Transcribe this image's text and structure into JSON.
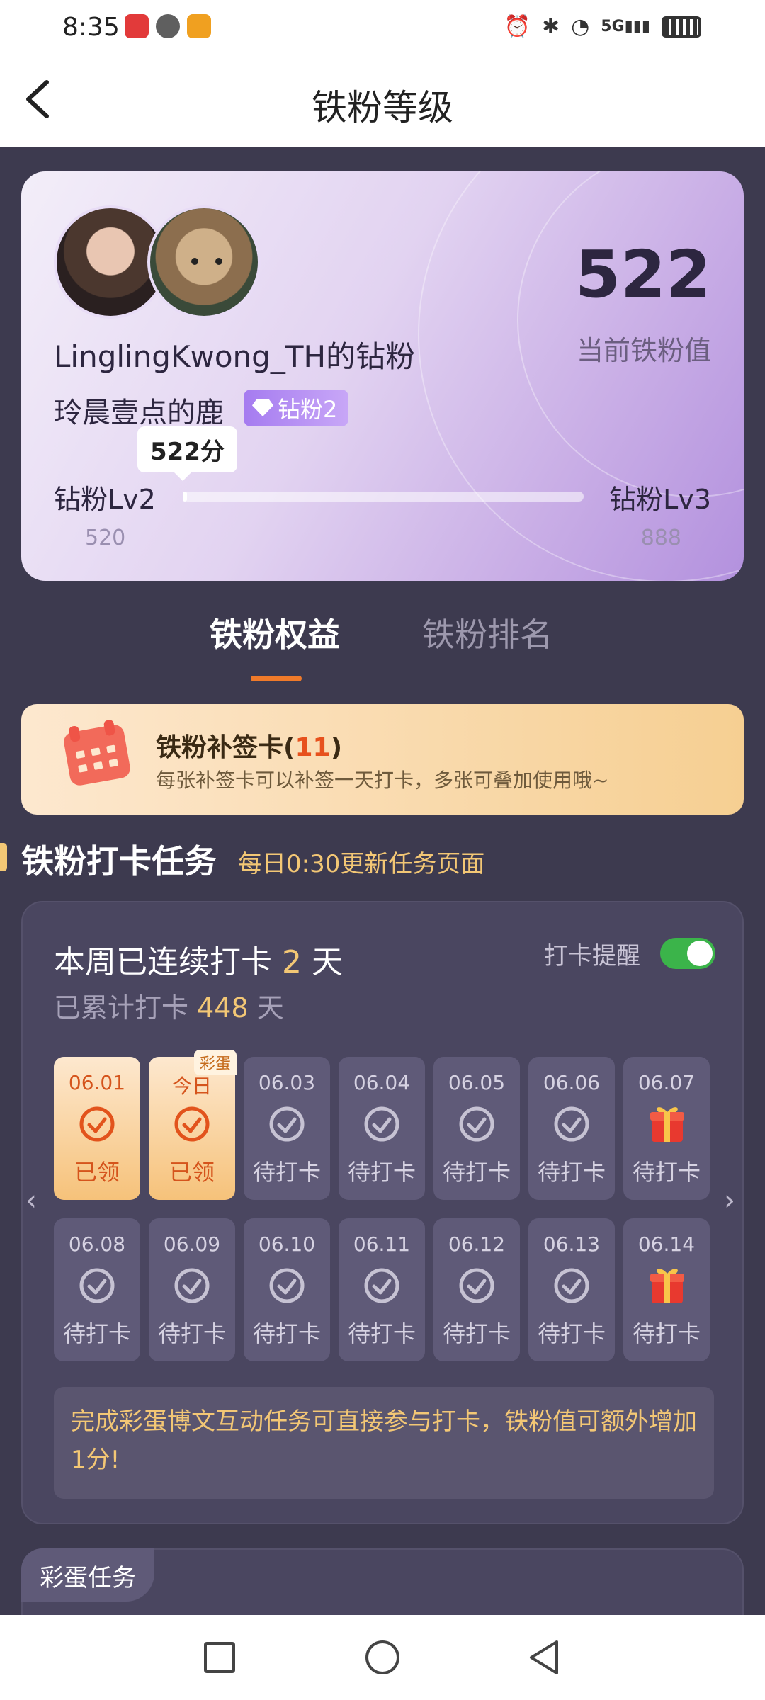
{
  "status_bar": {
    "time": "8:35",
    "network": "5G"
  },
  "header": {
    "title": "铁粉等级"
  },
  "profile": {
    "name": "LinglingKwong_TH的钻粉",
    "fan_name": "玲晨壹点的鹿",
    "badge": "钻粉2",
    "score": "522",
    "score_label": "当前铁粉值",
    "tooltip": "522分",
    "level_current": "钻粉Lv2",
    "level_next": "钻粉Lv3",
    "level_current_points": "520",
    "level_next_points": "888",
    "progress": 0.005
  },
  "tabs": [
    {
      "label": "铁粉权益",
      "active": true
    },
    {
      "label": "铁粉排名",
      "active": false
    }
  ],
  "sign_card": {
    "title_prefix": "铁粉补签卡(",
    "count": "11",
    "title_suffix": ")",
    "desc": "每张补签卡可以补签一天打卡，多张可叠加使用哦~"
  },
  "checkin": {
    "section_title": "铁粉打卡任务",
    "section_sub": "每日0:30更新任务页面",
    "streak_prefix": "本周已连续打卡 ",
    "streak_days": "2",
    "streak_suffix": " 天",
    "total_prefix": "已累计打卡 ",
    "total_days": "448",
    "total_suffix": " 天",
    "remind_label": "打卡提醒",
    "remind_on": true,
    "egg_tag": "彩蛋",
    "days": [
      {
        "date": "06.01",
        "label": "已领",
        "state": "done",
        "icon": "check-icon"
      },
      {
        "date": "今日",
        "label": "已领",
        "state": "done",
        "icon": "check-icon"
      },
      {
        "date": "06.03",
        "label": "待打卡",
        "state": "pending",
        "icon": "check-icon"
      },
      {
        "date": "06.04",
        "label": "待打卡",
        "state": "pending",
        "icon": "check-icon"
      },
      {
        "date": "06.05",
        "label": "待打卡",
        "state": "pending",
        "icon": "check-icon"
      },
      {
        "date": "06.06",
        "label": "待打卡",
        "state": "pending",
        "icon": "check-icon"
      },
      {
        "date": "06.07",
        "label": "待打卡",
        "state": "pending",
        "icon": "gift-icon"
      },
      {
        "date": "06.08",
        "label": "待打卡",
        "state": "pending",
        "icon": "check-icon"
      },
      {
        "date": "06.09",
        "label": "待打卡",
        "state": "pending",
        "icon": "check-icon"
      },
      {
        "date": "06.10",
        "label": "待打卡",
        "state": "pending",
        "icon": "check-icon"
      },
      {
        "date": "06.11",
        "label": "待打卡",
        "state": "pending",
        "icon": "check-icon"
      },
      {
        "date": "06.12",
        "label": "待打卡",
        "state": "pending",
        "icon": "check-icon"
      },
      {
        "date": "06.13",
        "label": "待打卡",
        "state": "pending",
        "icon": "check-icon"
      },
      {
        "date": "06.14",
        "label": "待打卡",
        "state": "pending",
        "icon": "gift-icon"
      }
    ],
    "note": "完成彩蛋博文互动任务可直接参与打卡，铁粉值可额外增加1分!"
  },
  "egg_tasks": {
    "label": "彩蛋任务"
  },
  "colors": {
    "accent": "#f07a2a",
    "gold": "#f3c775",
    "toggle_on": "#3bb44a",
    "background": "#3d3a4f"
  }
}
